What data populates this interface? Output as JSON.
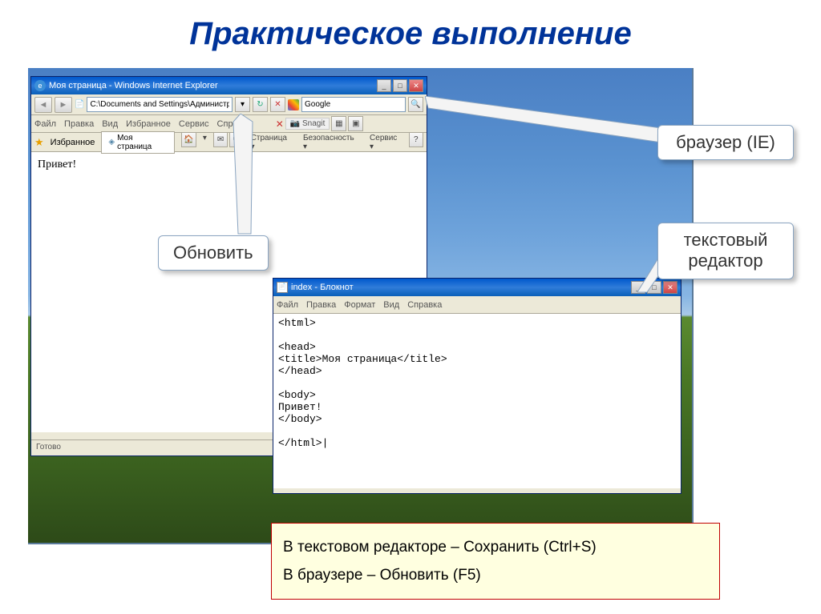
{
  "slide": {
    "title": "Практическое выполнение"
  },
  "ie": {
    "title": "Моя страница - Windows Internet Explorer",
    "address": "C:\\Documents and Settings\\Администратор\\Рабочий стол\\inde:",
    "search": "Google",
    "menu": {
      "file": "Файл",
      "edit": "Правка",
      "view": "Вид",
      "favorites": "Избранное",
      "tools": "Сервис",
      "help": "Справка"
    },
    "snagit": "Snagit",
    "fav_label": "Избранное",
    "tab_label": "Моя страница",
    "tb": {
      "page": "Страница",
      "safety": "Безопасность",
      "service": "Сервис"
    },
    "page_content": "Привет!",
    "status": "Готово"
  },
  "notepad": {
    "title": "index - Блокнот",
    "menu": {
      "file": "Файл",
      "edit": "Правка",
      "format": "Формат",
      "view": "Вид",
      "help": "Справка"
    },
    "content": "<html>\n\n<head>\n<title>Моя страница</title>\n</head>\n\n<body>\nПривет!\n</body>\n\n</html>|"
  },
  "callouts": {
    "refresh": "Обновить",
    "browser": "браузер (IE)",
    "editor": "текстовый редактор"
  },
  "instructions": {
    "line1": "В текстовом редакторе – Сохранить (Ctrl+S)",
    "line2": "В браузере – Обновить (F5)"
  }
}
